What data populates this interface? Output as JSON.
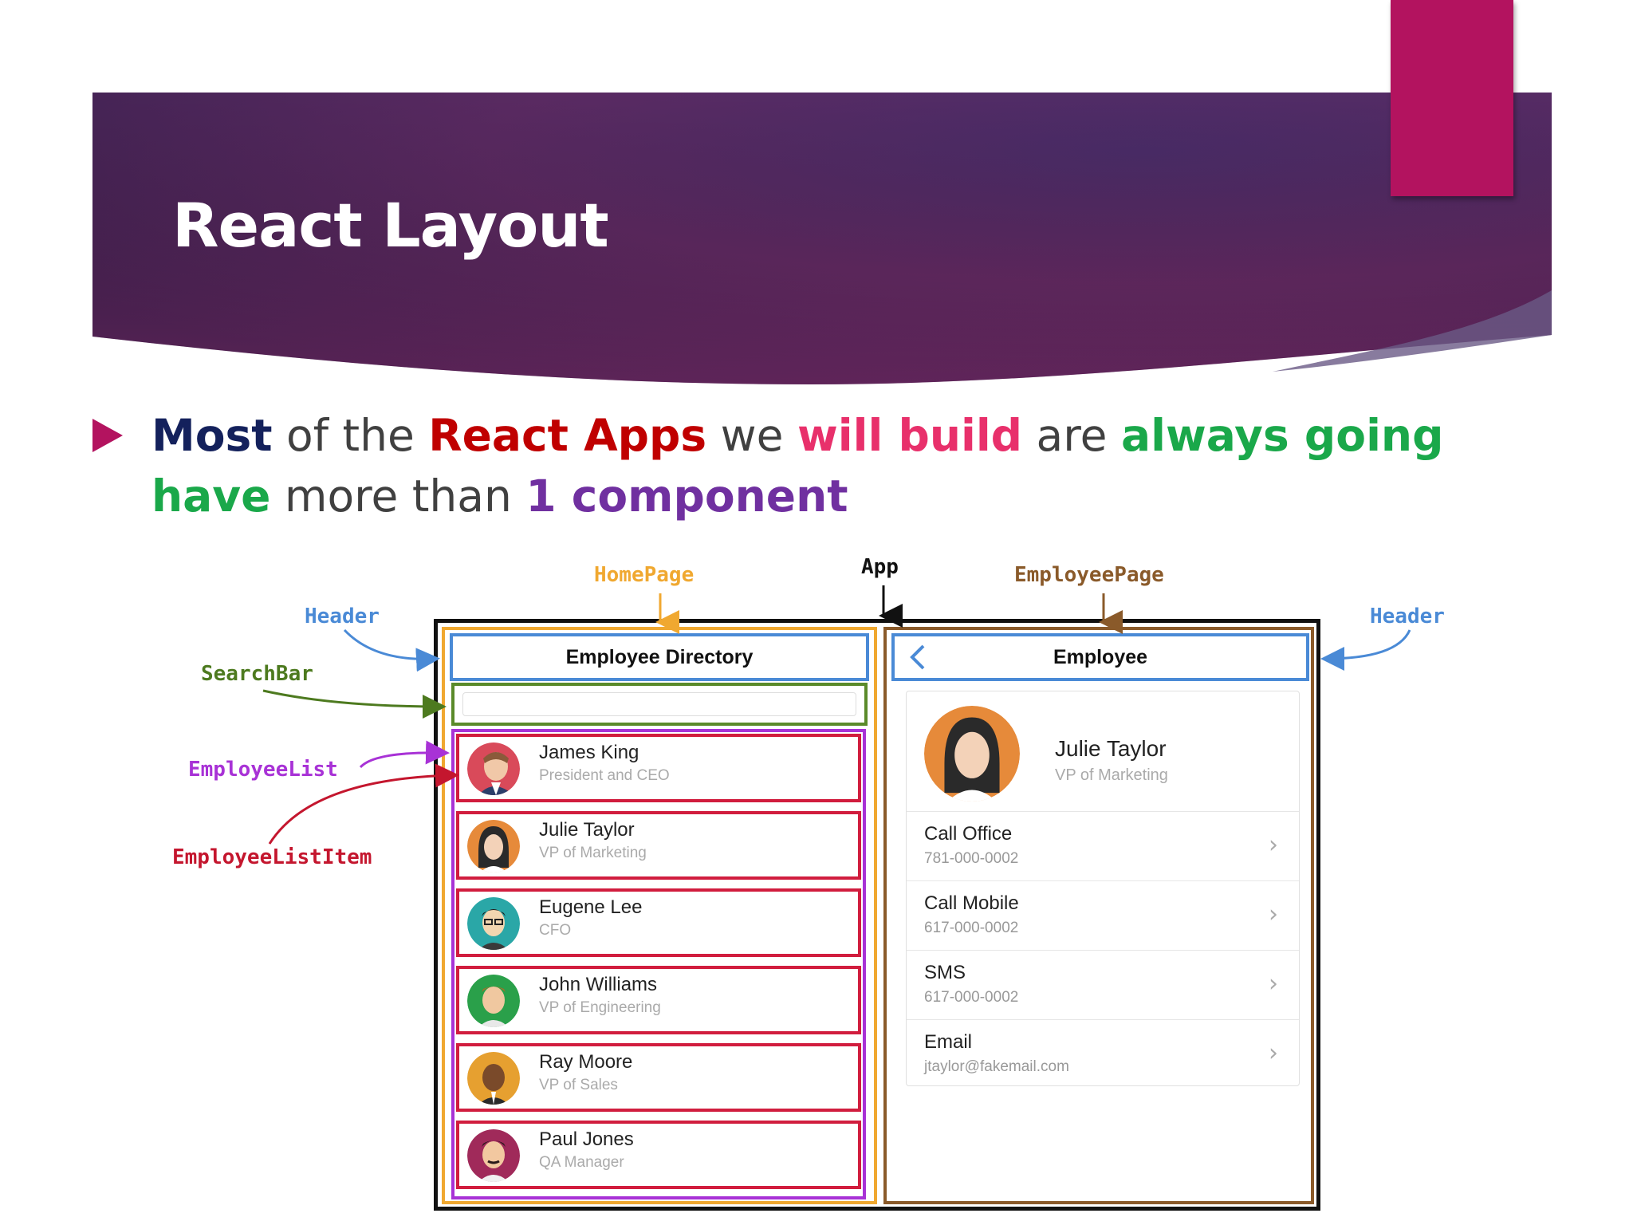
{
  "slide": {
    "title": "React Layout",
    "bullet": {
      "w1": "Most",
      "w2": " of the ",
      "w3": "React Apps",
      "w4": " we ",
      "w5": "will build",
      "w6": " are ",
      "w7": "always going have",
      "w8": " more than ",
      "w9": "1 component"
    }
  },
  "annotations": {
    "homepage": "HomePage",
    "app": "App",
    "employeepage": "EmployeePage",
    "header_left": "Header",
    "header_right": "Header",
    "searchbar": "SearchBar",
    "employeelist": "EmployeeList",
    "employeelistitem": "EmployeeListItem"
  },
  "home": {
    "header_title": "Employee Directory",
    "employees": [
      {
        "name": "James King",
        "title": "President and CEO"
      },
      {
        "name": "Julie Taylor",
        "title": "VP of Marketing"
      },
      {
        "name": "Eugene Lee",
        "title": "CFO"
      },
      {
        "name": "John Williams",
        "title": "VP of Engineering"
      },
      {
        "name": "Ray Moore",
        "title": "VP of Sales"
      },
      {
        "name": "Paul Jones",
        "title": "QA Manager"
      }
    ]
  },
  "employee_page": {
    "header_title": "Employee",
    "back_icon": "chevron-left-icon",
    "name": "Julie Taylor",
    "title": "VP of Marketing",
    "rows": [
      {
        "label": "Call Office",
        "value": "781-000-0002"
      },
      {
        "label": "Call Mobile",
        "value": "617-000-0002"
      },
      {
        "label": "SMS",
        "value": "617-000-0002"
      },
      {
        "label": "Email",
        "value": "jtaylor@fakemail.com"
      }
    ]
  },
  "colors": {
    "accent": "#b3135f",
    "header_blue": "#4a8ad6",
    "searchbar_green": "#5a8a2a",
    "list_purple": "#a832d6",
    "item_red": "#d11d3e",
    "homepage_orange": "#f0a830",
    "employeepage_brown": "#8a5a2a"
  }
}
